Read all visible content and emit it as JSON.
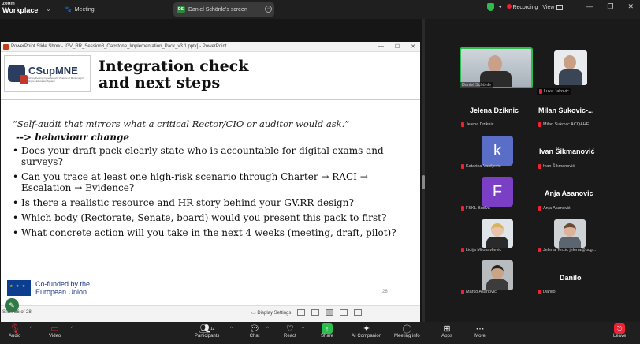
{
  "topbar": {
    "brand_line1": "zoom",
    "brand_line2": "Workplace",
    "meeting_tab": "Meeting",
    "share_tab": "Daniel Schönle's screen",
    "share_badge": "DS",
    "recording": "Recording",
    "view": "View"
  },
  "powerpoint": {
    "window_title": "PowerPoint Slide Show - [GV_RR_Session8_Capstone_Implementation_Pack_v3.1.pptx] - PowerPoint",
    "logo_name": "CSupMNE",
    "logo_tagline": "Strengthening CyberSecurity Posture of Montenegrin Higher Education System",
    "title_line1": "Integration check",
    "title_line2": "and next steps",
    "quote": "“Self-audit that mirrors what a critical Rector/CIO or auditor would ask.”",
    "arrow": "-->",
    "behaviour": "behaviour change",
    "bullets": [
      "Does your draft pack clearly state who is accountable for digital exams and surveys?",
      "Can you trace at least one high-risk scenario through Charter → RACI → Escalation → Evidence?",
      "Is there a realistic resource and HR story behind your GV.RR design?",
      "Which body (Rectorate, Senate, board) would you present this pack to first?",
      "What concrete action will you take in the next 4 weeks (meeting, draft, pilot)?"
    ],
    "eu_line1": "Co-funded by the",
    "eu_line2": "European Union",
    "page_number": "26",
    "slide_of": "Slide 26 of 28",
    "display_settings": "Display Settings",
    "zoom_value": "",
    "draw_icon": "pen-icon"
  },
  "participants": [
    {
      "name": "Daniel Schönle",
      "type": "video"
    },
    {
      "name": "Luka Jakovic",
      "type": "video"
    },
    {
      "name": "Jelena Dziknic",
      "type": "name",
      "big": "Jelena Dziknic"
    },
    {
      "name": "Milan Sukovic ACQAHE",
      "type": "name",
      "big": "Milan Sukovic-..."
    },
    {
      "name": "Katarina Vasiljevic",
      "type": "avatar",
      "letter": "k",
      "color": "#5b6ec7"
    },
    {
      "name": "Ivan Šikmanović",
      "type": "name",
      "big": "Ivan Šikmanović"
    },
    {
      "name": "FSKL Budva",
      "type": "avatar",
      "letter": "F",
      "color": "#7a3fc4"
    },
    {
      "name": "Anja Asanović",
      "type": "name",
      "big": "Anja Asanovic"
    },
    {
      "name": "Lidija Milosavljevic",
      "type": "photo"
    },
    {
      "name": "Jelena Terzic jelena@ucg...",
      "type": "photo"
    },
    {
      "name": "Marko Asanovic",
      "type": "photo"
    },
    {
      "name": "Danilo",
      "type": "name",
      "big": "Danilo"
    }
  ],
  "toolbar": {
    "audio": "Audio",
    "video": "Video",
    "participants": "Participants",
    "participants_count": "12",
    "chat": "Chat",
    "react": "React",
    "share": "Share",
    "ai_companion": "AI Companion",
    "meeting_info": "Meeting info",
    "apps": "Apps",
    "more": "More",
    "leave": "Leave"
  },
  "colors": {
    "recording_red": "#ee2233",
    "share_green": "#2dbd4f",
    "active_speaker": "#2dbd4f"
  }
}
